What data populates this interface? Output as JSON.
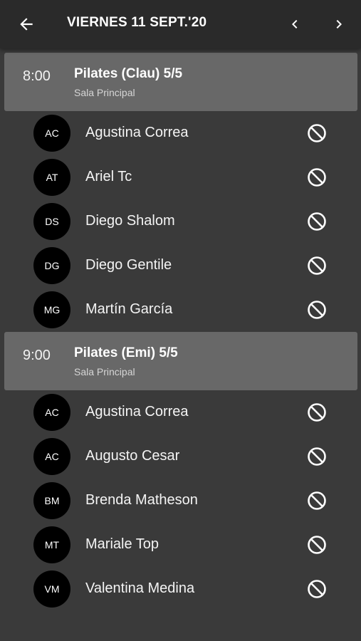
{
  "header": {
    "title": "VIERNES 11 SEPT.'20",
    "back_icon": "arrow-left-icon",
    "prev_icon": "chevron-left-icon",
    "next_icon": "chevron-right-icon"
  },
  "colors": {
    "background": "#3a3a3a",
    "topbar": "#2a2a2a",
    "session_header": "#686868",
    "avatar": "#000000",
    "text": "#ffffff"
  },
  "sessions": [
    {
      "time": "8:00",
      "title": "Pilates (Clau) 5/5",
      "room": "Sala Principal",
      "attendees": [
        {
          "initials": "AC",
          "name": "Agustina Correa",
          "action_icon": "block-icon"
        },
        {
          "initials": "AT",
          "name": "Ariel Tc",
          "action_icon": "block-icon"
        },
        {
          "initials": "DS",
          "name": "Diego Shalom",
          "action_icon": "block-icon"
        },
        {
          "initials": "DG",
          "name": "Diego Gentile",
          "action_icon": "block-icon"
        },
        {
          "initials": "MG",
          "name": "Martín García",
          "action_icon": "block-icon"
        }
      ]
    },
    {
      "time": "9:00",
      "title": "Pilates (Emi) 5/5",
      "room": "Sala Principal",
      "attendees": [
        {
          "initials": "AC",
          "name": "Agustina Correa",
          "action_icon": "block-icon"
        },
        {
          "initials": "AC",
          "name": "Augusto Cesar",
          "action_icon": "block-icon"
        },
        {
          "initials": "BM",
          "name": "Brenda Matheson",
          "action_icon": "block-icon"
        },
        {
          "initials": "MT",
          "name": "Mariale Top",
          "action_icon": "block-icon"
        },
        {
          "initials": "VM",
          "name": "Valentina Medina",
          "action_icon": "block-icon"
        }
      ]
    }
  ]
}
